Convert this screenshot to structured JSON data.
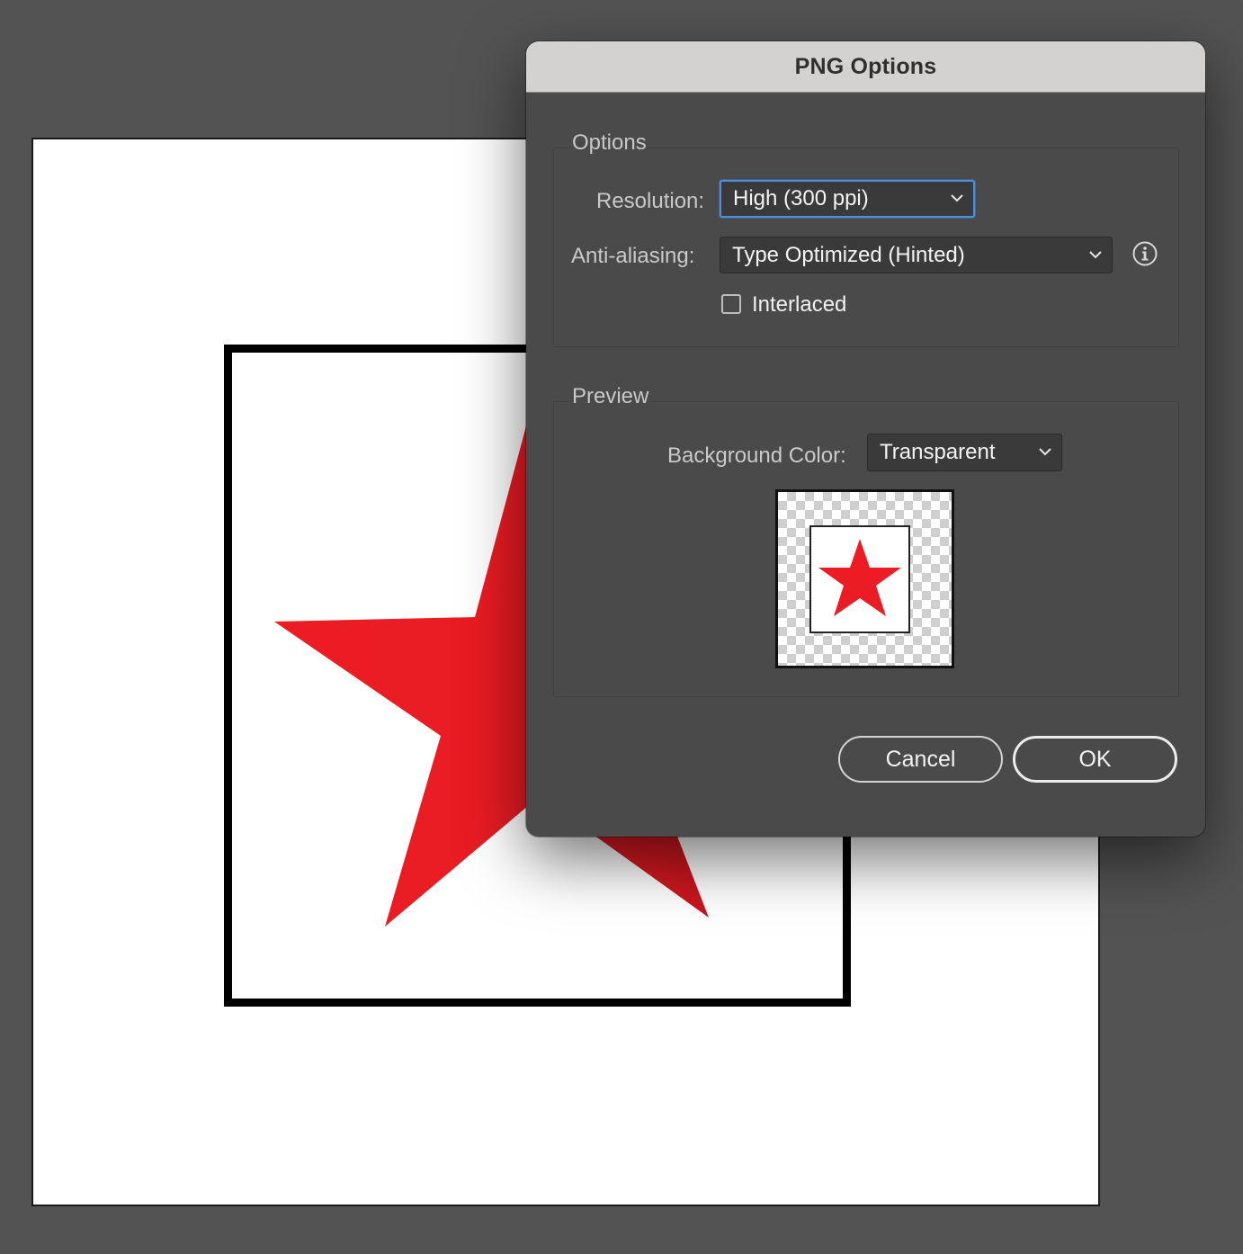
{
  "dialog": {
    "title": "PNG Options",
    "options_group": {
      "legend": "Options",
      "resolution": {
        "label": "Resolution:",
        "value": "High (300 ppi)"
      },
      "anti_aliasing": {
        "label": "Anti-aliasing:",
        "value": "Type Optimized (Hinted)"
      },
      "interlaced": {
        "label": "Interlaced",
        "checked": false
      }
    },
    "preview_group": {
      "legend": "Preview",
      "background_color": {
        "label": "Background Color:",
        "value": "Transparent"
      }
    },
    "buttons": {
      "cancel": "Cancel",
      "ok": "OK"
    }
  },
  "colors": {
    "star_red": "#ec1c24",
    "focus_blue": "#4a90e2",
    "dialog_bg": "#4a4a4a",
    "titlebar_bg": "#d3d2d1"
  },
  "icons": [
    "chevron-down-icon",
    "info-icon",
    "star-shape"
  ]
}
